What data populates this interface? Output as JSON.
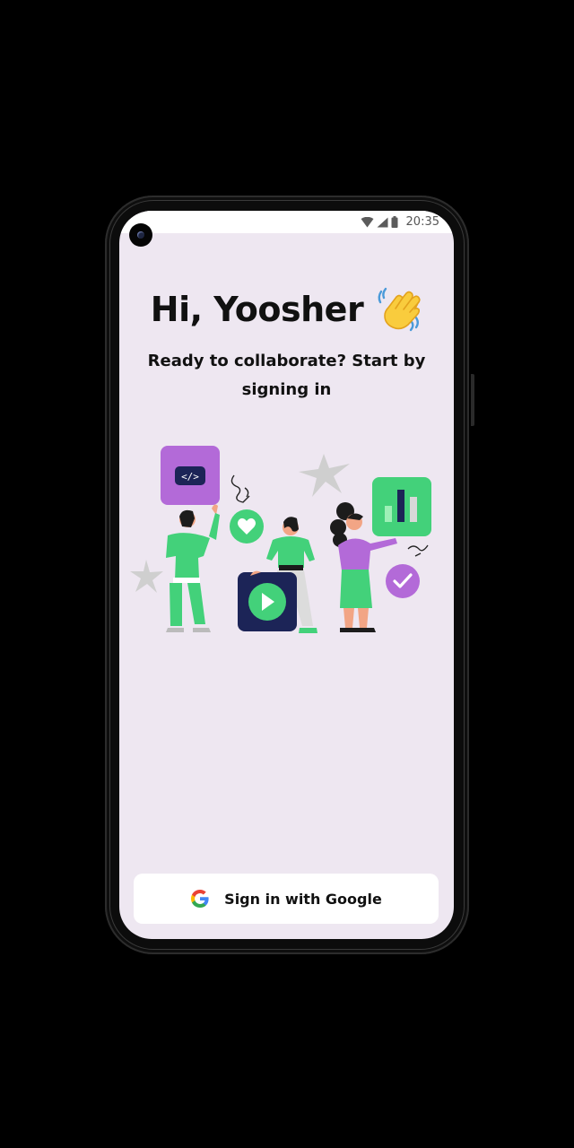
{
  "status_bar": {
    "time": "20:35",
    "icons": [
      "wifi-icon",
      "signal-icon",
      "battery-icon"
    ]
  },
  "greeting": {
    "title": "Hi, Yoosher",
    "emoji_icon": "waving-hand-icon",
    "subtitle": "Ready to collaborate? Start by signing in"
  },
  "illustration": {
    "icons": [
      "code-card-icon",
      "heart-badge-icon",
      "play-card-icon",
      "chart-card-icon",
      "check-badge-icon",
      "sparkle-icon"
    ]
  },
  "sign_in": {
    "label": "Sign in with Google",
    "icon": "google-logo-icon"
  },
  "colors": {
    "background": "#eee7f1",
    "purple": "#b36ad8",
    "green": "#43d17a",
    "navy": "#1c2457",
    "button": "#ffffff"
  }
}
